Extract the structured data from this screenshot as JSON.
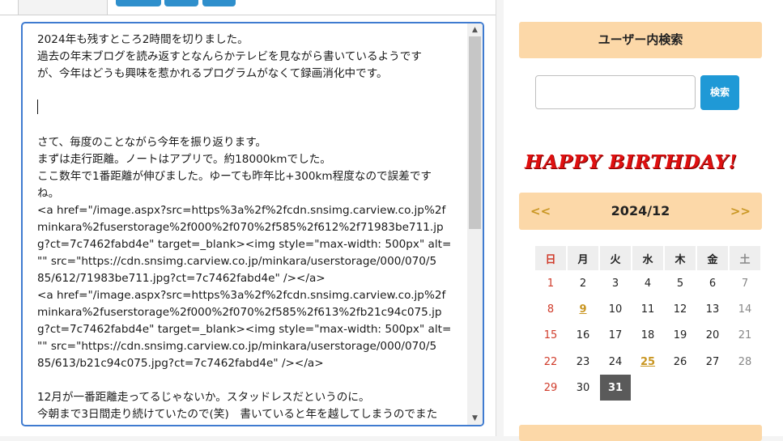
{
  "editor": {
    "lines": [
      "2024年も残すところ2時間を切りました。",
      "過去の年末ブログを読み返すとなんらかテレビを見ながら書いているようです",
      "が、今年はどうも興味を惹かれるプログラムがなくて録画消化中です。",
      "",
      "",
      "",
      "さて、毎度のことながら今年を振り返ります。",
      "まずは走行距離。ノートはアプリで。約18000kmでした。",
      "ここ数年で1番距離が伸びました。ゆーても昨年比+300km程度なので誤差です",
      "ね。",
      "<a href=\"/image.aspx?src=https%3a%2f%2fcdn.snsimg.carview.co.jp%2f",
      "minkara%2fuserstorage%2f000%2f070%2f585%2f612%2f71983be711.jp",
      "g?ct=7c7462fabd4e\" target=_blank><img style=\"max-width: 500px\" alt=",
      "\"\" src=\"https://cdn.snsimg.carview.co.jp/minkara/userstorage/000/070/5",
      "85/612/71983be711.jpg?ct=7c7462fabd4e\" /></a>",
      "<a href=\"/image.aspx?src=https%3a%2f%2fcdn.snsimg.carview.co.jp%2f",
      "minkara%2fuserstorage%2f000%2f070%2f585%2f613%2fb21c94c075.jp",
      "g?ct=7c7462fabd4e\" target=_blank><img style=\"max-width: 500px\" alt=",
      "\"\" src=\"https://cdn.snsimg.carview.co.jp/minkara/userstorage/000/070/5",
      "85/613/b21c94c075.jpg?ct=7c7462fabd4e\" /></a>",
      "",
      "12月が一番距離走ってるじゃないか。スタッドレスだというのに。",
      "今朝まで3日間走り続けていたので(笑)　書いていると年を越してしまうのでまた"
    ]
  },
  "sidebar": {
    "search_heading": "ユーザー内検索",
    "search_button": "検索",
    "search_value": "",
    "birthday_banner": "HAPPY BIRTHDAY!",
    "calendar": {
      "prev": "<<",
      "next": ">>",
      "title": "2024/12",
      "weekdays": [
        "日",
        "月",
        "火",
        "水",
        "木",
        "金",
        "土"
      ],
      "weeks": [
        [
          "1",
          "2",
          "3",
          "4",
          "5",
          "6",
          "7"
        ],
        [
          "8",
          "9",
          "10",
          "11",
          "12",
          "13",
          "14"
        ],
        [
          "15",
          "16",
          "17",
          "18",
          "19",
          "20",
          "21"
        ],
        [
          "22",
          "23",
          "24",
          "25",
          "26",
          "27",
          "28"
        ],
        [
          "29",
          "30",
          "31",
          "",
          "",
          "",
          ""
        ]
      ],
      "linked_days": [
        "9",
        "25"
      ],
      "today": "31"
    }
  },
  "colors": {
    "accent_blue": "#1f99d6",
    "heading_bg": "#fcd8a8",
    "calendar_link": "#c99622",
    "birthday_red": "#e01010",
    "sunday_red": "#d03b2a"
  }
}
